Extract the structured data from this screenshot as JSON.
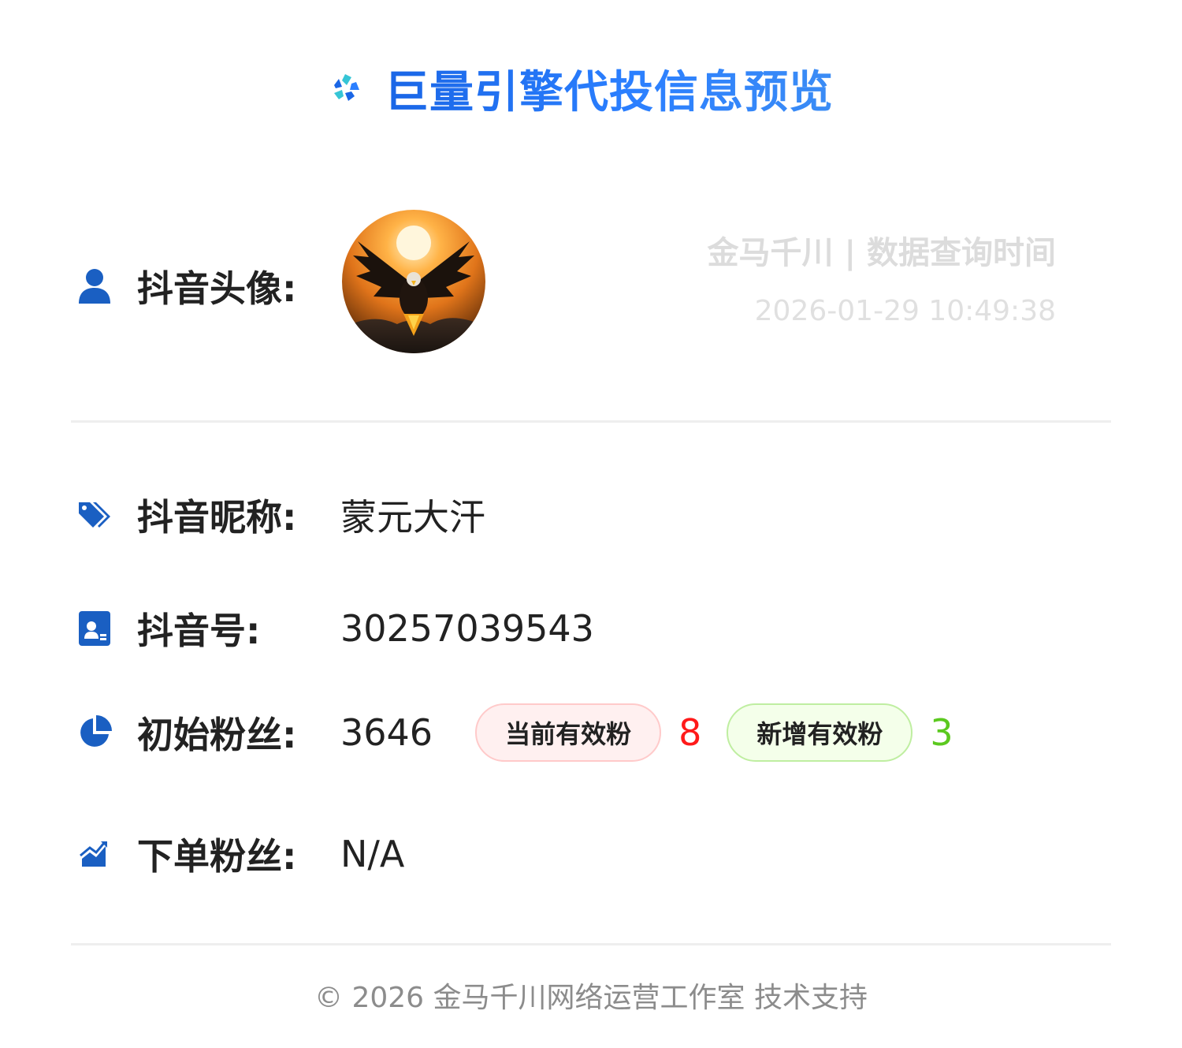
{
  "header": {
    "title": "巨量引擎代投信息预览",
    "logo_icon": "ocean-engine-logo-icon"
  },
  "profile": {
    "avatar_label": "抖音头像:",
    "avatar_icon": "user-icon",
    "avatar_alt": "eagle-sunset-avatar"
  },
  "query": {
    "brand_and_label": "金马千川 | 数据查询时间",
    "time": "2026-01-29 10:49:38"
  },
  "fields": {
    "nickname": {
      "icon": "tag-icon",
      "label": "抖音昵称:",
      "value": "蒙元大汗"
    },
    "douyin_id": {
      "icon": "id-card-icon",
      "label": "抖音号:",
      "value": "30257039543"
    },
    "initial_fans": {
      "icon": "pie-chart-icon",
      "label": "初始粉丝:",
      "value": "3646",
      "current_valid_label": "当前有效粉",
      "current_valid_count": "8",
      "new_valid_label": "新增有效粉",
      "new_valid_count": "3"
    },
    "order_fans": {
      "icon": "trend-up-icon",
      "label": "下单粉丝:",
      "value": "N/A"
    }
  },
  "footer": {
    "text": "© 2026 金马千川网络运营工作室 技术支持"
  },
  "colors": {
    "accent": "#1f6fe8",
    "icon": "#1a5fc2",
    "current_valid": "#ff1a1a",
    "new_valid": "#5bc91f"
  }
}
